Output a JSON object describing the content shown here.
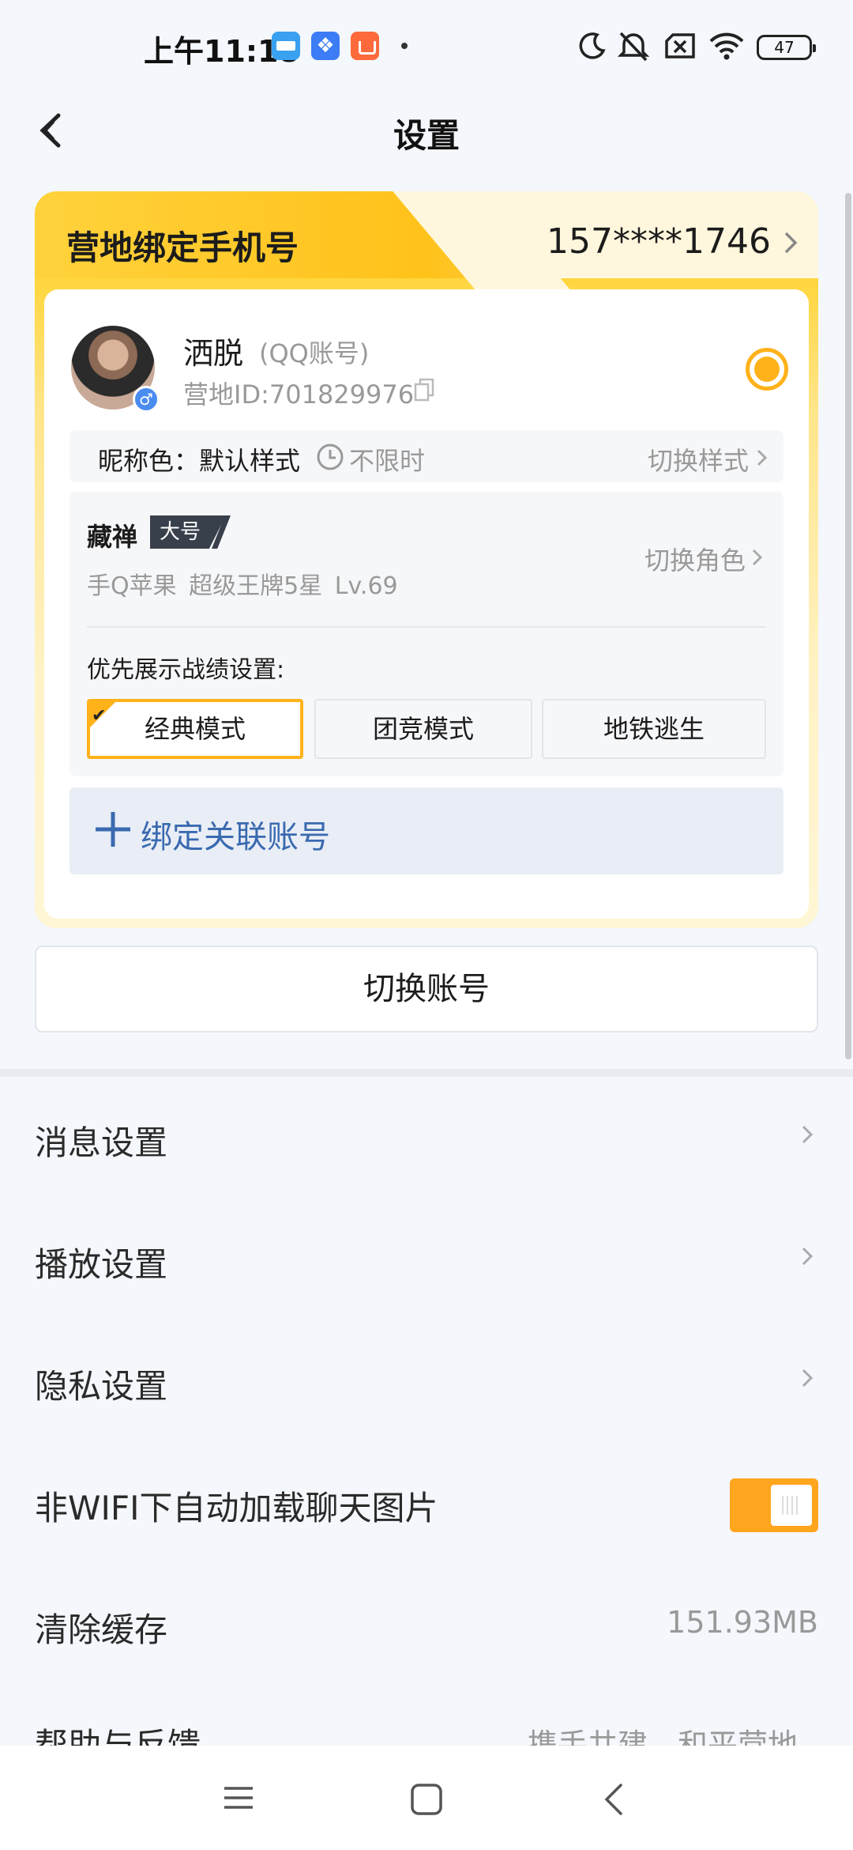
{
  "status_bar": {
    "time": "上午11:18",
    "battery": "47",
    "icons": [
      "calendar-app-icon",
      "blue-app-icon",
      "shop-app-icon",
      "moon-icon",
      "mute-icon",
      "sim-off-icon",
      "wifi-icon",
      "battery-icon"
    ]
  },
  "header": {
    "title": "设置"
  },
  "card": {
    "bind_phone_label": "营地绑定手机号",
    "phone": "157****1746",
    "user": {
      "name": "洒脱",
      "account_type": "(QQ账号)",
      "camp_id": "营地ID:701829976"
    },
    "nickname": {
      "label": "昵称色：默认样式",
      "duration": "不限时",
      "switch_label": "切换样式"
    },
    "role": {
      "name": "藏禅",
      "tag": "大号",
      "detail": "手Q苹果  超级王牌5星  Lv.69",
      "switch_label": "切换角色",
      "priority_label": "优先展示战绩设置:",
      "modes": [
        {
          "label": "经典模式",
          "selected": true
        },
        {
          "label": "团竞模式",
          "selected": false
        },
        {
          "label": "地铁逃生",
          "selected": false
        }
      ]
    },
    "bind_linked_label": "绑定关联账号"
  },
  "switch_account_label": "切换账号",
  "settings": [
    {
      "label": "消息设置",
      "type": "link"
    },
    {
      "label": "播放设置",
      "type": "link"
    },
    {
      "label": "隐私设置",
      "type": "link"
    },
    {
      "label": "非WIFI下自动加载聊天图片",
      "type": "toggle",
      "on": true
    },
    {
      "label": "清除缓存",
      "type": "value",
      "value": "151.93MB"
    }
  ],
  "help": {
    "label": "帮助与反馈",
    "value": "携手共建，和平营地"
  },
  "colors": {
    "accent": "#ffb21a",
    "link_blue": "#3a6ab0",
    "toggle_on": "#ffa51e"
  }
}
